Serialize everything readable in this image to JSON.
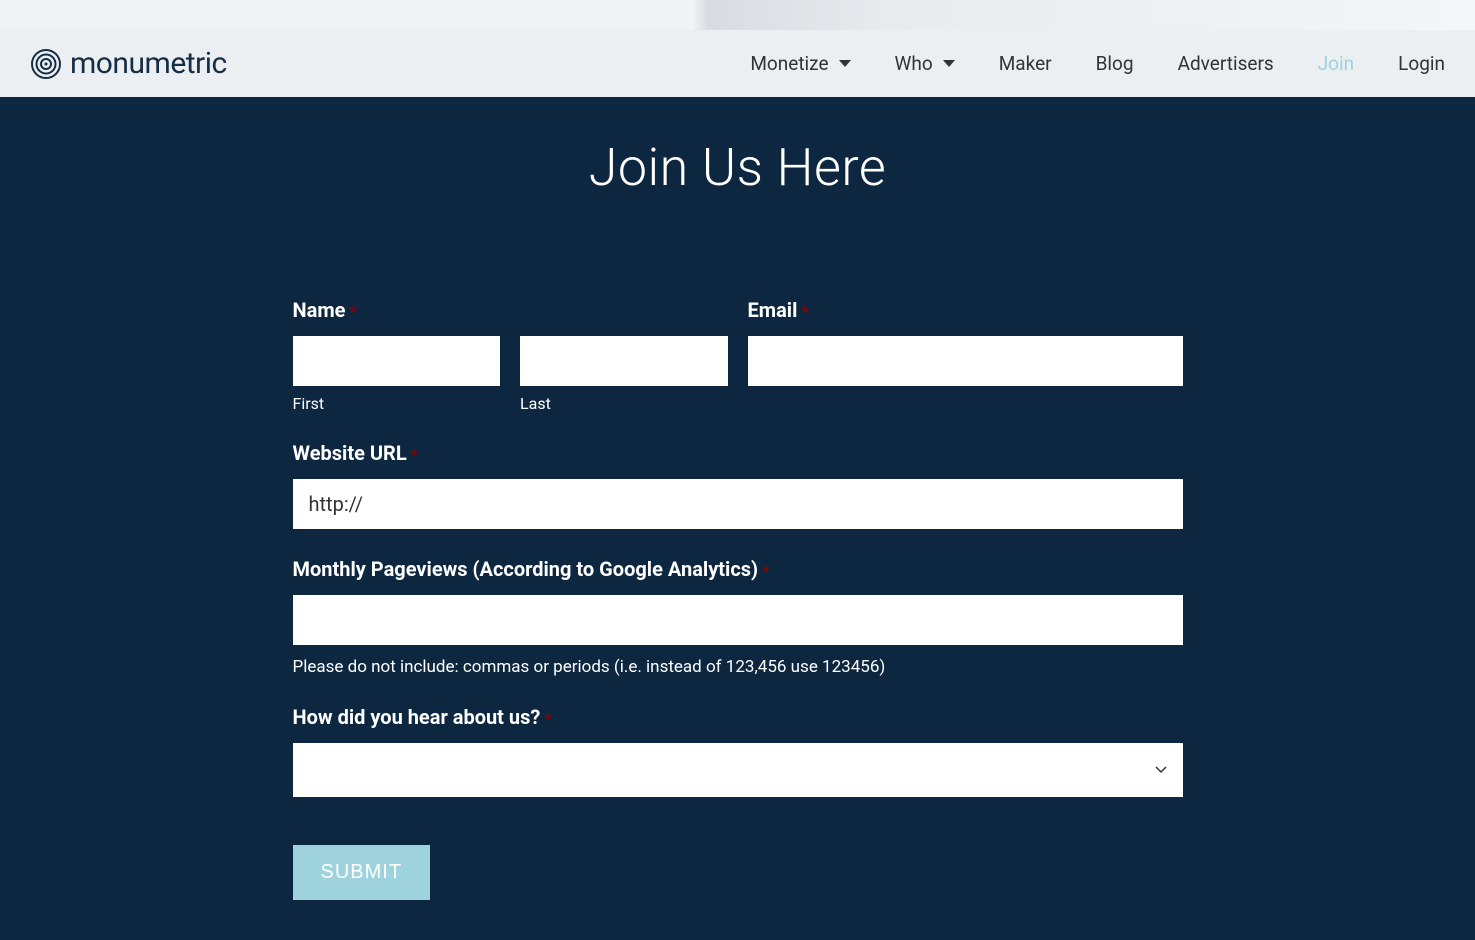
{
  "brand": "monumetric",
  "nav": {
    "items": [
      {
        "label": "Monetize",
        "dropdown": true,
        "active": false
      },
      {
        "label": "Who",
        "dropdown": true,
        "active": false
      },
      {
        "label": "Maker",
        "dropdown": false,
        "active": false
      },
      {
        "label": "Blog",
        "dropdown": false,
        "active": false
      },
      {
        "label": "Advertisers",
        "dropdown": false,
        "active": false
      },
      {
        "label": "Join",
        "dropdown": false,
        "active": true
      },
      {
        "label": "Login",
        "dropdown": false,
        "active": false
      }
    ]
  },
  "page": {
    "title": "Join Us Here"
  },
  "form": {
    "name_label": "Name",
    "first_sublabel": "First",
    "last_sublabel": "Last",
    "email_label": "Email",
    "website_label": "Website URL",
    "website_value": "http://",
    "pageviews_label": "Monthly Pageviews (According to Google Analytics)",
    "pageviews_helper": "Please do not include: commas or periods (i.e. instead of 123,456 use 123456)",
    "hear_label": "How did you hear about us?",
    "required_marker": "*",
    "submit_label": "SUBMIT"
  }
}
